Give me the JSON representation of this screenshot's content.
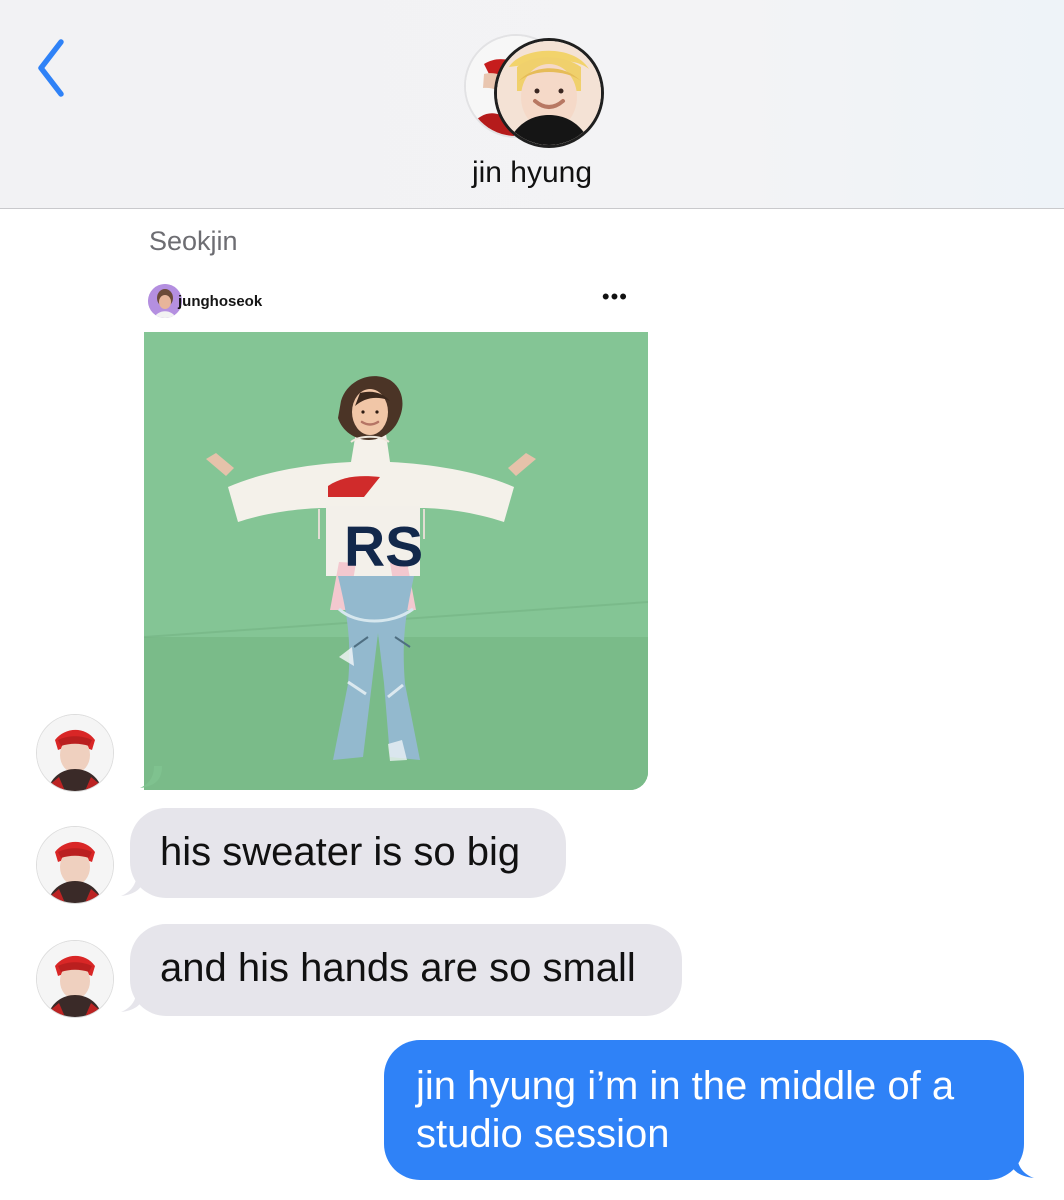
{
  "header": {
    "back_label": "Back",
    "contact_name": "jin hyung"
  },
  "conversation": {
    "sender": "Seokjin",
    "shared_post": {
      "username": "junghoseok",
      "more_label": "•••",
      "photo_text": "RS"
    },
    "messages": [
      {
        "direction": "incoming",
        "text": "his sweater is so big"
      },
      {
        "direction": "incoming",
        "text": "and his hands are so small"
      },
      {
        "direction": "outgoing",
        "line1": "jin hyung i’m in the middle of a",
        "line2": "studio session"
      }
    ]
  },
  "colors": {
    "incoming_bubble": "#e6e5eb",
    "outgoing_bubble": "#2f82f7",
    "accent_blue": "#2f82f7",
    "header_background": "#f2f2f4"
  },
  "icons": {
    "back": "chevron-left-icon",
    "avatar": "contact-avatar",
    "more": "more-dots-icon"
  }
}
